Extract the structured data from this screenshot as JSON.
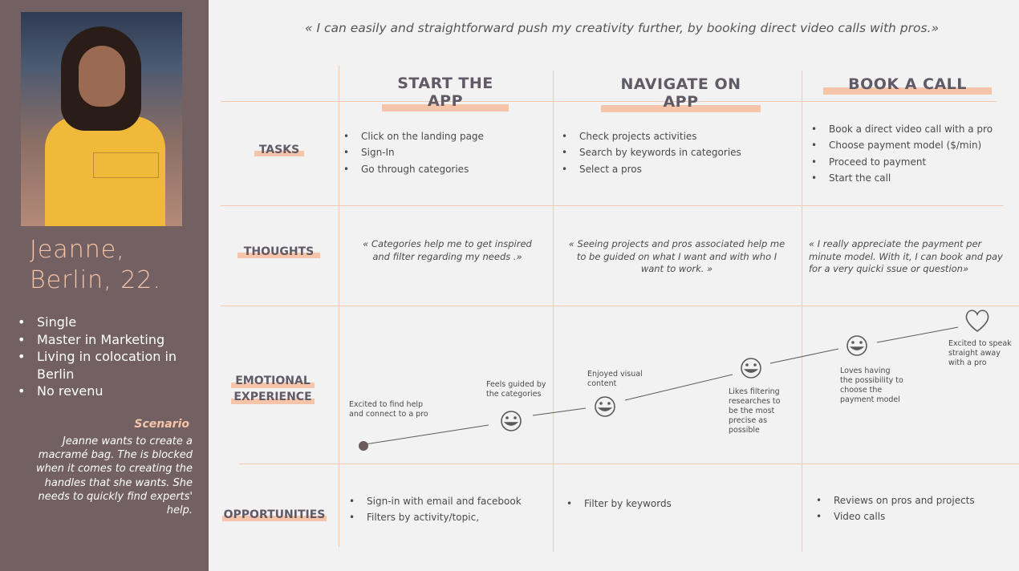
{
  "persona": {
    "name_line1": "Jeanne,",
    "name_line2": "Berlin, 22.",
    "facts": [
      "Single",
      "Master in Marketing",
      "Living in colocation in Berlin",
      "No revenu"
    ],
    "scenario_title": "Scenario",
    "scenario_text": "Jeanne wants to create a macramé bag. The is blocked when it comes to creating the handles that she wants. She needs to quickly find experts' help."
  },
  "quote": "« I can easily and straightforward push my creativity further, by booking direct video calls with pros.»",
  "columns": [
    "START THE APP",
    "NAVIGATE ON APP",
    "BOOK A CALL"
  ],
  "rows": {
    "tasks": "TASKS",
    "thoughts": "THOUGHTS",
    "emotional_line1": "EMOTIONAL",
    "emotional_line2": "EXPERIENCE",
    "opportunities": "OPPORTUNITIES"
  },
  "tasks": [
    [
      "Click on the landing page",
      "Sign-In",
      "Go through categories"
    ],
    [
      "Check projects activities",
      "Search by keywords in categories",
      "Select a pros"
    ],
    [
      "Book a direct video call with a pro",
      "Choose payment model ($/min)",
      "Proceed to payment",
      "Start the call"
    ]
  ],
  "thoughts": [
    "« Categories help me to get inspired and filter regarding my needs .»",
    "« Seeing projects and pros associated help me to be guided on what I want and with who I want to work. »",
    "«  I really appreciate the payment per minute model. With it, I can book and pay for a very quicki ssue or question»"
  ],
  "emotions": [
    {
      "label": "Excited to find help and connect to a pro",
      "icon": "dot"
    },
    {
      "label": "Feels guided by the categories",
      "icon": "smiley"
    },
    {
      "label": "Enjoyed visual content",
      "icon": "smiley"
    },
    {
      "label": "Likes filtering researches to be the most precise as possible",
      "icon": "smiley"
    },
    {
      "label": "Loves having the possibility to choose the payment model",
      "icon": "smiley"
    },
    {
      "label": "Excited to speak straight away with a pro",
      "icon": "heart"
    }
  ],
  "opportunities": [
    [
      "Sign-in with email and facebook",
      "Filters by activity/topic,"
    ],
    [
      "Filter by keywords"
    ],
    [
      "Reviews on pros and projects",
      "Video calls"
    ]
  ],
  "colors": {
    "sidebar": "#726062",
    "accent": "#f6c4a8",
    "heading": "#5f5a66",
    "grid": "#f3c8ae"
  }
}
